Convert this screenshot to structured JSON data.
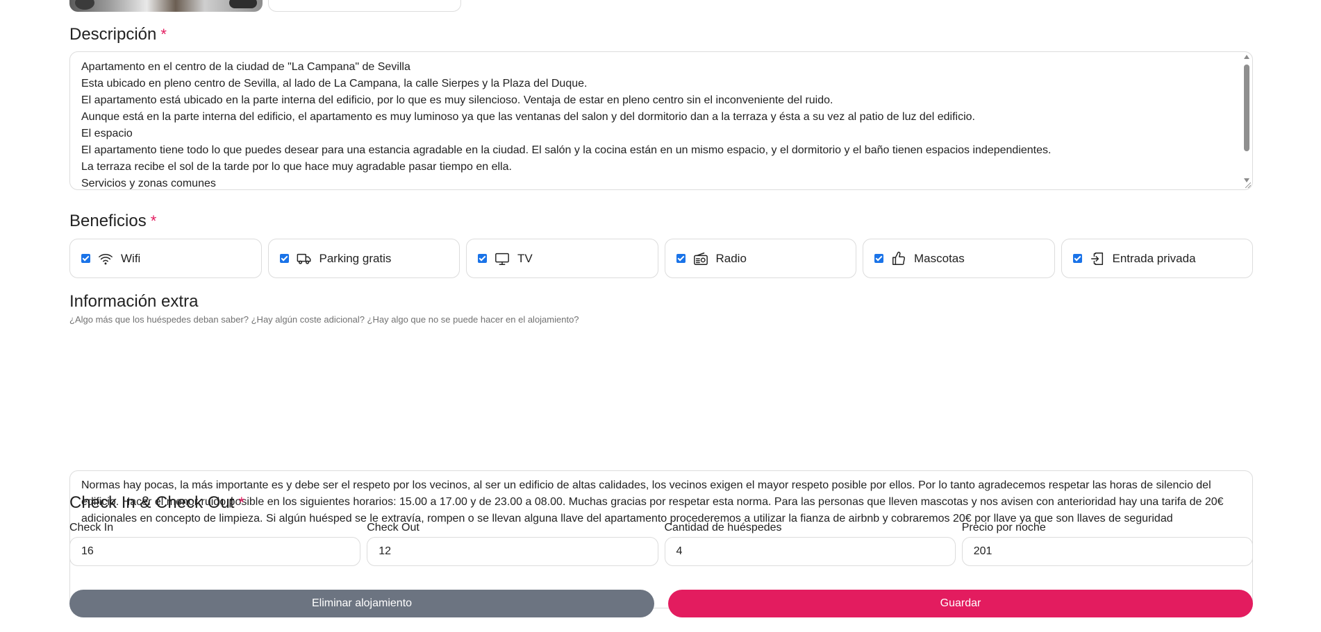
{
  "descripcion": {
    "title": "Descripción",
    "required_mark": "*",
    "lines": [
      "Apartamento en el centro de la ciudad de \"La Campana\" de Sevilla",
      "Esta ubicado en pleno centro de Sevilla, al lado de La Campana, la calle Sierpes y la Plaza del Duque.",
      "El apartamento está ubicado en la parte interna del edificio, por lo que es muy silencioso. Ventaja de estar en pleno centro sin el inconveniente del ruido.",
      "Aunque está en la parte interna del edificio, el apartamento es muy luminoso ya que las ventanas del salon y del dormitorio dan a la terraza y ésta a su vez al patio de luz del edificio.",
      "El espacio",
      "El apartamento tiene todo lo que puedes desear para una estancia agradable en la ciudad. El salón y la cocina están en un mismo espacio, y el dormitorio y el baño tienen espacios independientes.",
      "La terraza recibe el sol de la tarde por lo que hace muy agradable pasar tiempo en ella.",
      "Servicios y zonas comunes"
    ]
  },
  "beneficios": {
    "title": "Beneficios",
    "required_mark": "*",
    "items": [
      {
        "label": "Wifi",
        "icon": "wifi-icon",
        "checked": true
      },
      {
        "label": "Parking gratis",
        "icon": "truck-icon",
        "checked": true
      },
      {
        "label": "TV",
        "icon": "tv-icon",
        "checked": true
      },
      {
        "label": "Radio",
        "icon": "radio-icon",
        "checked": true
      },
      {
        "label": "Mascotas",
        "icon": "thumbs-up-icon",
        "checked": true
      },
      {
        "label": "Entrada privada",
        "icon": "door-enter-icon",
        "checked": true
      }
    ]
  },
  "extra": {
    "title": "Información extra",
    "hint": "¿Algo más que los huéspedes deban saber? ¿Hay algún coste adicional? ¿Hay algo que no se puede hacer en el alojamiento?",
    "text": "Normas hay pocas, la más importante es y debe ser el respeto por los vecinos, al ser un edificio de altas calidades, los vecinos exigen el mayor respeto posible por ellos. Por lo tanto agradecemos respetar las horas de silencio del edificio. Hacer el menor ruido posible en los siguientes horarios: 15.00 a 17.00 y de 23.00 a 08.00. Muchas gracias por respetar esta norma. Para las personas que lleven mascotas y nos avisen con anterioridad hay una tarifa de 20€ adicionales en concepto de limpieza. Si algún huésped se le extravía, rompen o se llevan alguna llave del apartamento procederemos a utilizar la fianza de airbnb y cobraremos 20€ por llave ya que son llaves de seguridad"
  },
  "checkin": {
    "title": "Check In & Check Out",
    "required_mark": "*",
    "fields": [
      {
        "label": "Check In",
        "value": "16"
      },
      {
        "label": "Check Out",
        "value": "12"
      },
      {
        "label": "Cantidad de huéspedes",
        "value": "4"
      },
      {
        "label": "Precio por noche",
        "value": "201"
      }
    ]
  },
  "actions": {
    "delete_label": "Eliminar alojamiento",
    "save_label": "Guardar"
  },
  "colors": {
    "accent": "#e31c5f",
    "delete_button": "#6c7481",
    "checkbox": "#1a73e8"
  }
}
